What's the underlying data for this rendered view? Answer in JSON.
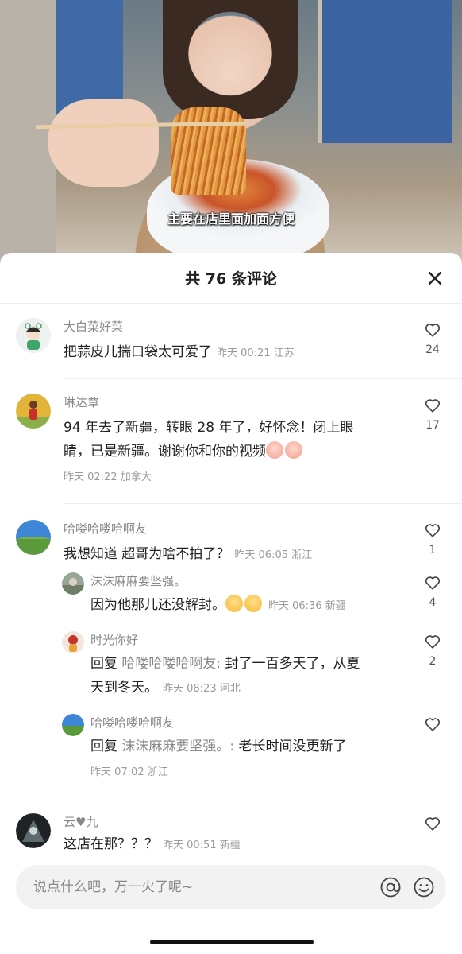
{
  "video": {
    "subtitle": "主要在店里面加面方便"
  },
  "sheet": {
    "title": "共 76 条评论"
  },
  "comments": [
    {
      "name": "大白菜好菜",
      "text": "把蒜皮儿揣口袋太可爱了",
      "meta": "昨天 00:21 江苏",
      "likes": "24"
    },
    {
      "name": "琳达覃",
      "text": "94 年去了新疆，转眼 28 年了，好怀念！闭上眼",
      "text2": "睛，已是新疆。谢谢你和你的视频",
      "meta": "昨天 02:22 加拿大",
      "likes": "17"
    },
    {
      "name": "哈喽哈喽哈啊友",
      "text": "我想知道  超哥为啥不拍了？",
      "meta": "昨天 06:05 浙江",
      "likes": "1"
    },
    {
      "name": "云♥九",
      "text": "这店在那？？？",
      "meta": "昨天 00:51 新疆"
    }
  ],
  "replies": [
    {
      "name": "沫沫麻麻要坚强。",
      "text": "因为他那儿还没解封。",
      "meta": "昨天 06:36 新疆",
      "likes": "4"
    },
    {
      "name": "时光你好",
      "prefix": "回复",
      "target": "哈喽哈喽哈啊友:",
      "text": " 封了一百多天了，从夏",
      "text2": "天到冬天。",
      "meta": "昨天 08:23 河北",
      "likes": "2"
    },
    {
      "name": "哈喽哈喽哈啊友",
      "prefix": "回复",
      "target": "沫沫麻麻要坚强。:",
      "text": " 老长时间没更新了",
      "meta": "昨天 07:02 浙江"
    }
  ],
  "input": {
    "placeholder": "说点什么吧，万一火了呢~"
  },
  "icons": {
    "close": "close-icon",
    "like": "heart-outline-icon",
    "mention": "at-icon",
    "emoji": "smiley-icon"
  }
}
